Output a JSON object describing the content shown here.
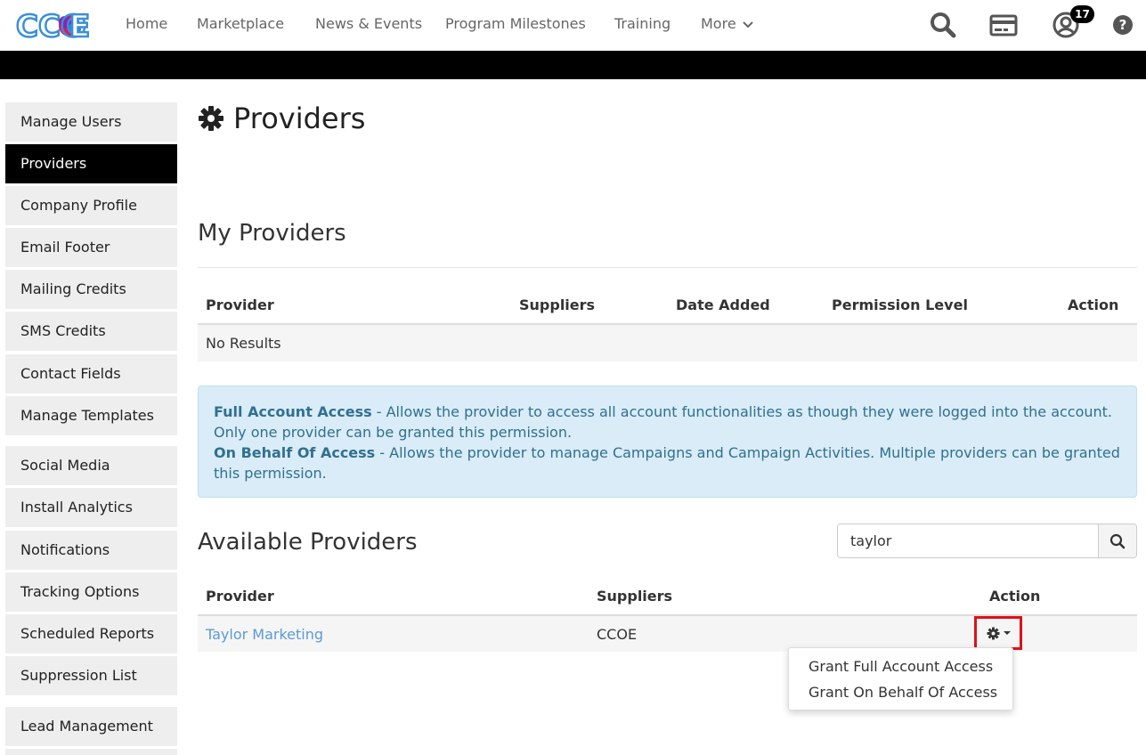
{
  "brand": {
    "logo_text": "CCOE",
    "accent": "#1e88e5"
  },
  "nav": {
    "items": [
      "Home",
      "Marketplace",
      "News & Events",
      "Program Milestones",
      "Training",
      "More"
    ],
    "notification_count": "17"
  },
  "sidebar": {
    "items": [
      {
        "label": "Manage Users"
      },
      {
        "label": "Providers",
        "active": true
      },
      {
        "label": "Company Profile"
      },
      {
        "label": "Email Footer"
      },
      {
        "label": "Mailing Credits"
      },
      {
        "label": "SMS Credits"
      },
      {
        "label": "Contact Fields"
      },
      {
        "label": "Manage Templates"
      },
      {
        "label": "Social Media"
      },
      {
        "label": "Install Analytics"
      },
      {
        "label": "Notifications"
      },
      {
        "label": "Tracking Options"
      },
      {
        "label": "Scheduled Reports"
      },
      {
        "label": "Suppression List"
      },
      {
        "label": "Lead Management"
      }
    ]
  },
  "page": {
    "title": "Providers"
  },
  "my_providers": {
    "title": "My Providers",
    "columns": [
      "Provider",
      "Suppliers",
      "Date Added",
      "Permission Level",
      "Action"
    ],
    "empty_text": "No Results"
  },
  "info": {
    "full_label": "Full Account Access",
    "full_text": " - Allows the provider to access all account functionalities as though they were logged into the account. Only one provider can be granted this permission.",
    "behalf_label": "On Behalf Of Access",
    "behalf_text": " - Allows the provider to manage Campaigns and Campaign Activities. Multiple providers can be granted this permission."
  },
  "available_providers": {
    "title": "Available Providers",
    "search_value": "taylor",
    "columns": [
      "Provider",
      "Suppliers",
      "Action"
    ],
    "rows": [
      {
        "provider": "Taylor Marketing",
        "suppliers": "CCOE"
      }
    ]
  },
  "action_menu": {
    "items": [
      "Grant Full Account Access",
      "Grant On Behalf Of Access"
    ]
  }
}
